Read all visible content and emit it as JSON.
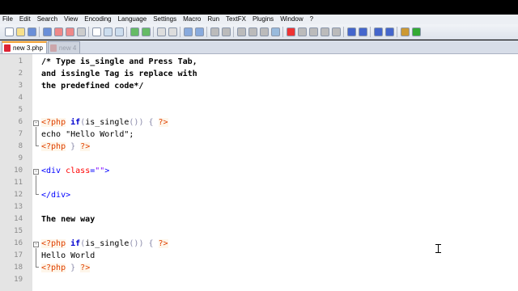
{
  "menu": [
    "File",
    "Edit",
    "Search",
    "View",
    "Encoding",
    "Language",
    "Settings",
    "Macro",
    "Run",
    "TextFX",
    "Plugins",
    "Window",
    "?"
  ],
  "toolbar": {
    "buttons": [
      "new-file-icon",
      "open-file-icon",
      "save-icon",
      "save-all-icon",
      "close-icon",
      "close-all-icon",
      "print-icon",
      "cut-icon",
      "copy-icon",
      "paste-icon",
      "undo-icon",
      "redo-icon",
      "find-icon",
      "replace-icon",
      "zoom-in-icon",
      "zoom-out-icon",
      "sync-v-icon",
      "sync-h-icon",
      "wrap-icon",
      "show-all-icon",
      "indent-guide-icon",
      "doc-map-icon",
      "record-icon",
      "stop-icon",
      "play-icon",
      "play-multiple-icon",
      "save-macro-icon",
      "fold-all-icon",
      "unfold-all-icon",
      "prev-icon",
      "next-icon",
      "run-icon",
      "check-icon"
    ]
  },
  "tabs": [
    {
      "label": "new 3.php",
      "active": true
    },
    {
      "label": "new 4",
      "active": false
    }
  ],
  "editor": {
    "lines": [
      {
        "n": "1",
        "parts": [
          {
            "t": "/* Type is_single and Press Tab,",
            "c": "comment"
          }
        ]
      },
      {
        "n": "2",
        "parts": [
          {
            "t": "and issingle Tag is replace with",
            "c": "comment"
          }
        ]
      },
      {
        "n": "3",
        "parts": [
          {
            "t": "the predefined code*/",
            "c": "comment"
          }
        ]
      },
      {
        "n": "4",
        "parts": []
      },
      {
        "n": "5",
        "parts": []
      },
      {
        "n": "6",
        "parts": [
          {
            "t": "<?php",
            "c": "php-tag"
          },
          {
            "t": " ",
            "c": "plain"
          },
          {
            "t": "if",
            "c": "php-kw"
          },
          {
            "t": "(",
            "c": "php-punc"
          },
          {
            "t": "is_single",
            "c": "php-fn"
          },
          {
            "t": "()) { ",
            "c": "php-punc"
          },
          {
            "t": "?>",
            "c": "php-tag"
          }
        ]
      },
      {
        "n": "7",
        "parts": [
          {
            "t": "echo \"Hello World\";",
            "c": "plain"
          }
        ]
      },
      {
        "n": "8",
        "parts": [
          {
            "t": "<?php",
            "c": "php-tag"
          },
          {
            "t": " } ",
            "c": "php-punc"
          },
          {
            "t": "?>",
            "c": "php-tag"
          }
        ]
      },
      {
        "n": "9",
        "parts": []
      },
      {
        "n": "10",
        "parts": [
          {
            "t": "<div ",
            "c": "html-tag"
          },
          {
            "t": "class",
            "c": "html-attr"
          },
          {
            "t": "=",
            "c": "html-eq"
          },
          {
            "t": "\"\"",
            "c": "html-str"
          },
          {
            "t": ">",
            "c": "html-tag"
          }
        ]
      },
      {
        "n": "11",
        "parts": []
      },
      {
        "n": "12",
        "parts": [
          {
            "t": "</div>",
            "c": "html-tag"
          }
        ]
      },
      {
        "n": "13",
        "parts": []
      },
      {
        "n": "14",
        "parts": [
          {
            "t": "The new way",
            "c": "bold-text"
          }
        ]
      },
      {
        "n": "15",
        "parts": []
      },
      {
        "n": "16",
        "parts": [
          {
            "t": "<?php",
            "c": "php-tag"
          },
          {
            "t": " ",
            "c": "plain"
          },
          {
            "t": "if",
            "c": "php-kw"
          },
          {
            "t": "(",
            "c": "php-punc"
          },
          {
            "t": "is_single",
            "c": "php-fn"
          },
          {
            "t": "()) { ",
            "c": "php-punc"
          },
          {
            "t": "?>",
            "c": "php-tag"
          }
        ]
      },
      {
        "n": "17",
        "parts": [
          {
            "t": "Hello World",
            "c": "plain"
          }
        ]
      },
      {
        "n": "18",
        "parts": [
          {
            "t": "<?php",
            "c": "php-tag"
          },
          {
            "t": " } ",
            "c": "php-punc"
          },
          {
            "t": "?>",
            "c": "php-tag"
          }
        ]
      },
      {
        "n": "19",
        "parts": []
      }
    ]
  }
}
